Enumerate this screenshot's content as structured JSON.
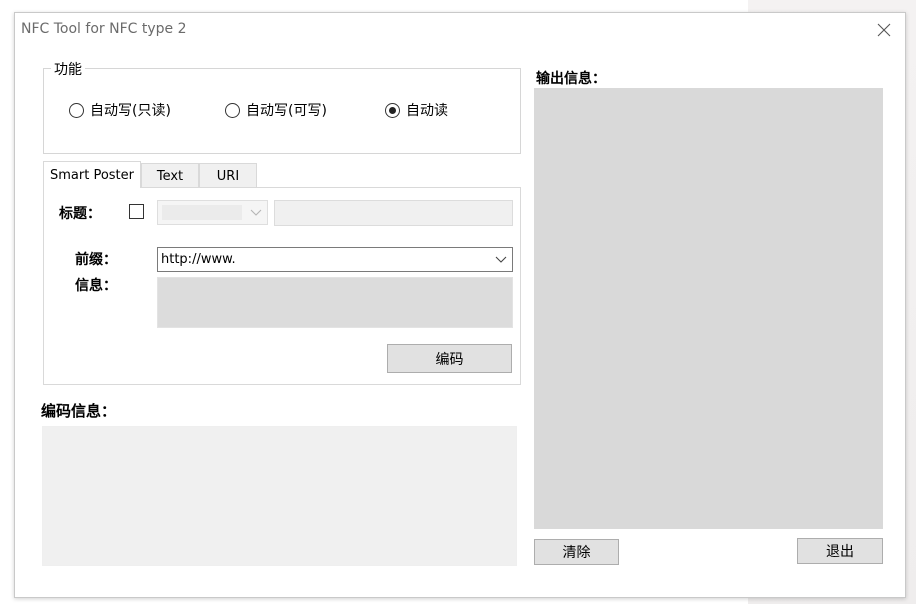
{
  "window": {
    "title": "NFC Tool for NFC type 2"
  },
  "function_group": {
    "label": "功能",
    "options": [
      {
        "label": "自动写(只读)",
        "checked": false
      },
      {
        "label": "自动写(可写)",
        "checked": false
      },
      {
        "label": "自动读",
        "checked": true
      }
    ]
  },
  "tabs": [
    {
      "label": "Smart Poster",
      "active": true
    },
    {
      "label": "Text",
      "active": false
    },
    {
      "label": "URI",
      "active": false
    }
  ],
  "smart_poster": {
    "title_label": "标题：",
    "prefix_label": "前缀：",
    "prefix_value": "http://www.",
    "info_label": "信息：",
    "encode_button": "编码"
  },
  "encode_info": {
    "label": "编码信息："
  },
  "output": {
    "label": "输出信息：",
    "clear_button": "清除",
    "exit_button": "退出"
  }
}
